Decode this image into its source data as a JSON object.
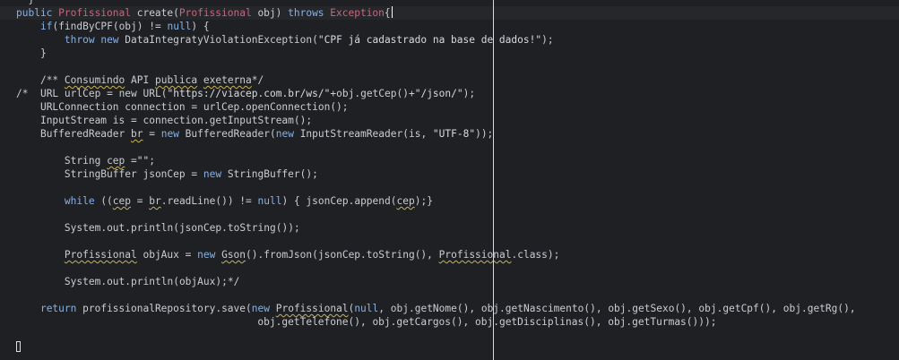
{
  "editor": {
    "lines": [
      {
        "indent": "  ",
        "text": "}"
      },
      {
        "indent": "",
        "segments": [
          {
            "cls": "kw",
            "t": "public "
          },
          {
            "cls": "type",
            "t": "Profissional "
          },
          {
            "cls": "",
            "t": "create("
          },
          {
            "cls": "type",
            "t": "Profissional "
          },
          {
            "cls": "",
            "t": "obj) "
          },
          {
            "cls": "kw",
            "t": "throws "
          },
          {
            "cls": "type",
            "t": "Exception"
          },
          {
            "cls": "",
            "t": "{"
          }
        ],
        "cursor": true
      },
      {
        "indent": "    ",
        "text": "if(findByCPF(obj) != null) {"
      },
      {
        "indent": "        ",
        "text": "throw new DataIntegratyViolationException(\"CPF já cadastrado na base de dados!\");"
      },
      {
        "indent": "    ",
        "text": "}"
      },
      {
        "indent": "",
        "text": ""
      },
      {
        "indent": "    ",
        "text": "/** Consumindo API publica exeterna*/"
      },
      {
        "indent": "",
        "text": "/*  URL urlCep = new URL(\"https://viacep.com.br/ws/\"+obj.getCep()+\"/json/\");"
      },
      {
        "indent": "    ",
        "text": "URLConnection connection = urlCep.openConnection();"
      },
      {
        "indent": "    ",
        "text": "InputStream is = connection.getInputStream();"
      },
      {
        "indent": "    ",
        "text": "BufferedReader br = new BufferedReader(new InputStreamReader(is, \"UTF-8\"));"
      },
      {
        "indent": "",
        "text": ""
      },
      {
        "indent": "        ",
        "text": "String cep =\"\";"
      },
      {
        "indent": "        ",
        "text": "StringBuffer jsonCep = new StringBuffer();"
      },
      {
        "indent": "",
        "text": ""
      },
      {
        "indent": "        ",
        "text": "while ((cep = br.readLine()) != null) { jsonCep.append(cep);}"
      },
      {
        "indent": "",
        "text": ""
      },
      {
        "indent": "        ",
        "text": "System.out.println(jsonCep.toString());"
      },
      {
        "indent": "",
        "text": ""
      },
      {
        "indent": "        ",
        "text": "Profissional objAux = new Gson().fromJson(jsonCep.toString(), Profissional.class);"
      },
      {
        "indent": "",
        "text": ""
      },
      {
        "indent": "        ",
        "text": "System.out.println(objAux);*/"
      },
      {
        "indent": "",
        "text": ""
      },
      {
        "indent": "    ",
        "text": "return profissionalRepository.save(new Profissional(null, obj.getNome(), obj.getNascimento(), obj.getSexo(), obj.getCpf(), obj.getRg(),"
      },
      {
        "indent": "                                        ",
        "text": "obj.getTelefone(), obj.getCargos(), obj.getDisciplinas(), obj.getTurmas()));"
      }
    ]
  }
}
